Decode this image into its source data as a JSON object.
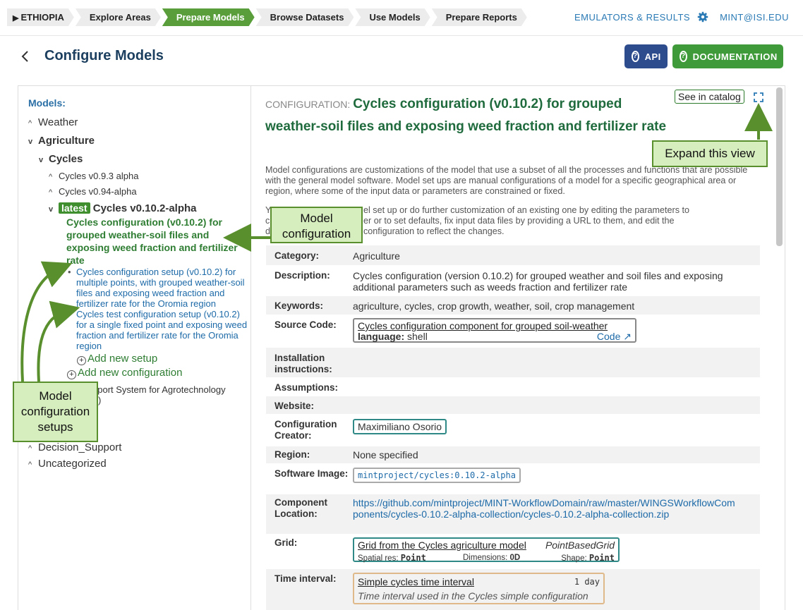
{
  "nav": {
    "crumbs": [
      {
        "label": "ETHIOPIA",
        "marker": "▶"
      },
      {
        "label": "Explore Areas"
      },
      {
        "label": "Prepare Models"
      },
      {
        "label": "Browse Datasets"
      },
      {
        "label": "Use Models"
      },
      {
        "label": "Prepare Reports"
      }
    ],
    "active_crumb": "Prepare Models",
    "emulators_label": "EMULATORS & RESULTS",
    "user_email": "MINT@ISI.EDU"
  },
  "header": {
    "title": "Configure Models",
    "api_label": "API",
    "doc_label": "DOCUMENTATION"
  },
  "sidebar": {
    "title": "Models:",
    "items": {
      "weather": "Weather",
      "agriculture": "Agriculture",
      "cycles": "Cycles",
      "cycles_093": "Cycles v0.9.3 alpha",
      "cycles_094": "Cycles v0.94-alpha",
      "latest_badge": "latest",
      "cycles_0102": "Cycles v0.10.2-alpha",
      "selected_config": "Cycles configuration (v0.10.2) for grouped weather-soil files and exposing weed fraction and fertilizer rate",
      "setup_1": "Cycles configuration setup (v0.10.2) for multiple points, with grouped weather-soil files and exposing weed fraction and fertilizer rate for the Oromia region",
      "setup_2": "Cycles test configuration setup (v0.10.2) for a single fixed point and exposing weed fraction and fertilizer rate for the Oromia region",
      "add_setup": "Add new setup",
      "add_config": "Add new configuration",
      "dssat_partial_1": "pport System for Agrotechnology",
      "dssat_partial_2": "T)",
      "decision_support": "Decision_Support",
      "uncategorized": "Uncategorized"
    }
  },
  "config": {
    "label": "CONFIGURATION:",
    "title": "Cycles configuration (v0.10.2) for grouped weather-soil files and exposing weed fraction and fertilizer rate",
    "see_catalog": "See in catalog",
    "intro_1": "Model configurations are customizations of the model that use a subset of all the processes and functions that are possible with the general model software. Model set ups are manual configurations of a model for a specific geographical area or region, where some of the input data or parameters are constrained or fixed.",
    "intro_2a": "Y",
    "intro_2b": "el set up or do further customization of an existing one by editing the parameters to",
    "intro_2c": "c",
    "intro_2d": "er or to set defaults, fix input data files by providing a URL to them, and edit the",
    "intro_2e": "d",
    "intro_2f": "configuration to reflect the changes.",
    "rows": {
      "category_label": "Category:",
      "category": "Agriculture",
      "description_label": "Description:",
      "description": "Cycles configuration (version 0.10.2) for grouped weather and soil files and exposing additional parameters such as weeds fraction and fertilizer rate",
      "keywords_label": "Keywords:",
      "keywords": "agriculture, cycles, crop growth, weather, soil, crop management",
      "source_label": "Source Code:",
      "source_name": "Cycles configuration component for grouped soil-weather",
      "source_lang_label": "language:",
      "source_lang": "shell",
      "source_code_link": "Code",
      "install_label": "Installation instructions:",
      "assumptions_label": "Assumptions:",
      "website_label": "Website:",
      "creator_label": "Configuration Creator:",
      "creator": "Maximiliano Osorio",
      "region_label": "Region:",
      "region": "None specified",
      "image_label": "Software Image:",
      "image": "mintproject/cycles:0.10.2-alpha",
      "location_label": "Component Location:",
      "location": "https://github.com/mintproject/MINT-WorkflowDomain/raw/master/WINGSWorkflowComponents/cycles-0.10.2-alpha-collection/cycles-0.10.2-alpha-collection.zip",
      "grid_label": "Grid:",
      "grid_name": "Grid from the Cycles agriculture model",
      "grid_type": "PointBasedGrid",
      "grid_res_label": "Spatial res:",
      "grid_res": "Point",
      "grid_dim_label": "Dimensions:",
      "grid_dim": "0D",
      "grid_shape_label": "Shape:",
      "grid_shape": "Point",
      "time_label": "Time interval:",
      "time_name": "Simple cycles time interval",
      "time_value": "1 day",
      "time_desc": "Time interval used in the Cycles simple configuration"
    }
  },
  "annotations": {
    "expand": "Expand this view",
    "model_config": "Model configuration",
    "setups": "Model configuration setups"
  },
  "colors": {
    "active_crumb": "#5a9e3c",
    "api_button": "#2d4c8e",
    "doc_button": "#3f9a3a",
    "title_blue": "#1c3f5f",
    "config_green": "#1f6b3d",
    "callout_bg": "#d6eebe",
    "callout_border": "#5a8f2e"
  }
}
